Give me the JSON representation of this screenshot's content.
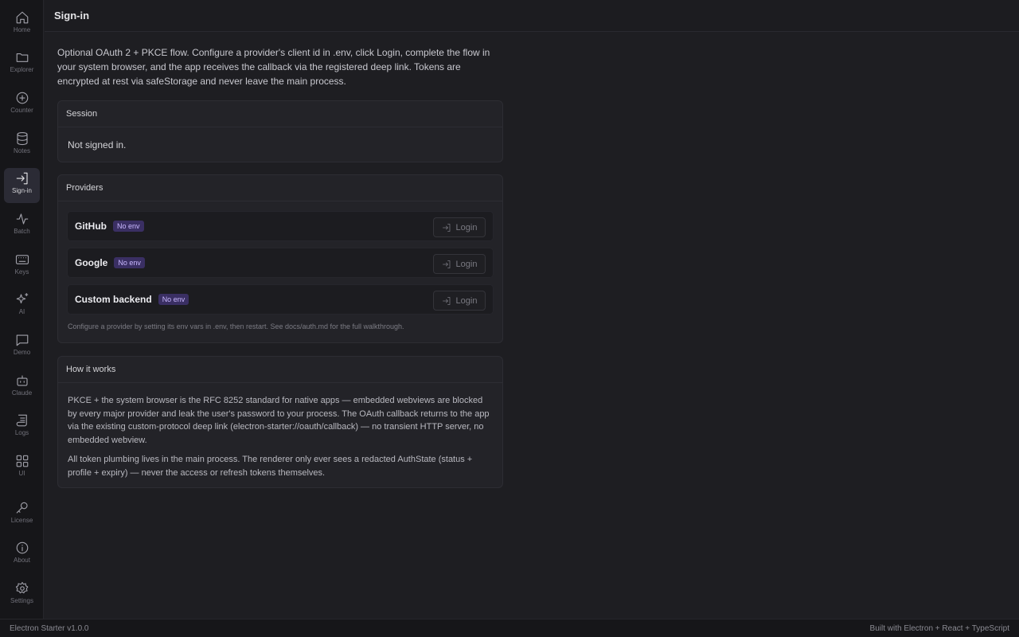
{
  "sidebar": {
    "items": [
      {
        "label": "Home",
        "icon": "home-icon"
      },
      {
        "label": "Explorer",
        "icon": "folder-icon"
      },
      {
        "label": "Counter",
        "icon": "plus-circle-icon"
      },
      {
        "label": "Notes",
        "icon": "database-icon"
      },
      {
        "label": "Sign-in",
        "icon": "sign-in-icon",
        "active": true
      },
      {
        "label": "Batch",
        "icon": "activity-icon"
      },
      {
        "label": "Keys",
        "icon": "keyboard-icon"
      },
      {
        "label": "AI",
        "icon": "sparkles-icon"
      },
      {
        "label": "Demo",
        "icon": "message-square-icon"
      },
      {
        "label": "Claude",
        "icon": "bot-icon"
      },
      {
        "label": "Logs",
        "icon": "scroll-icon"
      },
      {
        "label": "UI",
        "icon": "grid-icon"
      },
      {
        "label": "License",
        "icon": "key-icon"
      },
      {
        "label": "About",
        "icon": "info-icon"
      },
      {
        "label": "Settings",
        "icon": "gear-icon"
      }
    ]
  },
  "header": {
    "title": "Sign-in"
  },
  "intro": "Optional OAuth 2 + PKCE flow. Configure a provider's client id in .env, click Login, complete the flow in your system browser, and the app receives the callback via the registered deep link. Tokens are encrypted at rest via safeStorage and never leave the main process.",
  "session": {
    "title": "Session",
    "status": "Not signed in."
  },
  "providers": {
    "title": "Providers",
    "items": [
      {
        "name": "GitHub",
        "badge": "No env",
        "login": "Login"
      },
      {
        "name": "Google",
        "badge": "No env",
        "login": "Login"
      },
      {
        "name": "Custom backend",
        "badge": "No env",
        "login": "Login"
      }
    ],
    "hint": "Configure a provider by setting its env vars in .env, then restart. See docs/auth.md for the full walkthrough."
  },
  "how": {
    "title": "How it works",
    "p1": "PKCE + the system browser is the RFC 8252 standard for native apps — embedded webviews are blocked by every major provider and leak the user's password to your process. The OAuth callback returns to the app via the existing custom-protocol deep link (electron-starter://oauth/callback) — no transient HTTP server, no embedded webview.",
    "p2": "All token plumbing lives in the main process. The renderer only ever sees a redacted AuthState (status + profile + expiry) — never the access or refresh tokens themselves."
  },
  "footer": {
    "left": "Electron Starter v1.0.0",
    "right": "Built with Electron + React + TypeScript"
  },
  "colors": {
    "accent_badge_bg": "#3a2f63",
    "accent_badge_text": "#c9b8ff",
    "background": "#1e1e22"
  }
}
